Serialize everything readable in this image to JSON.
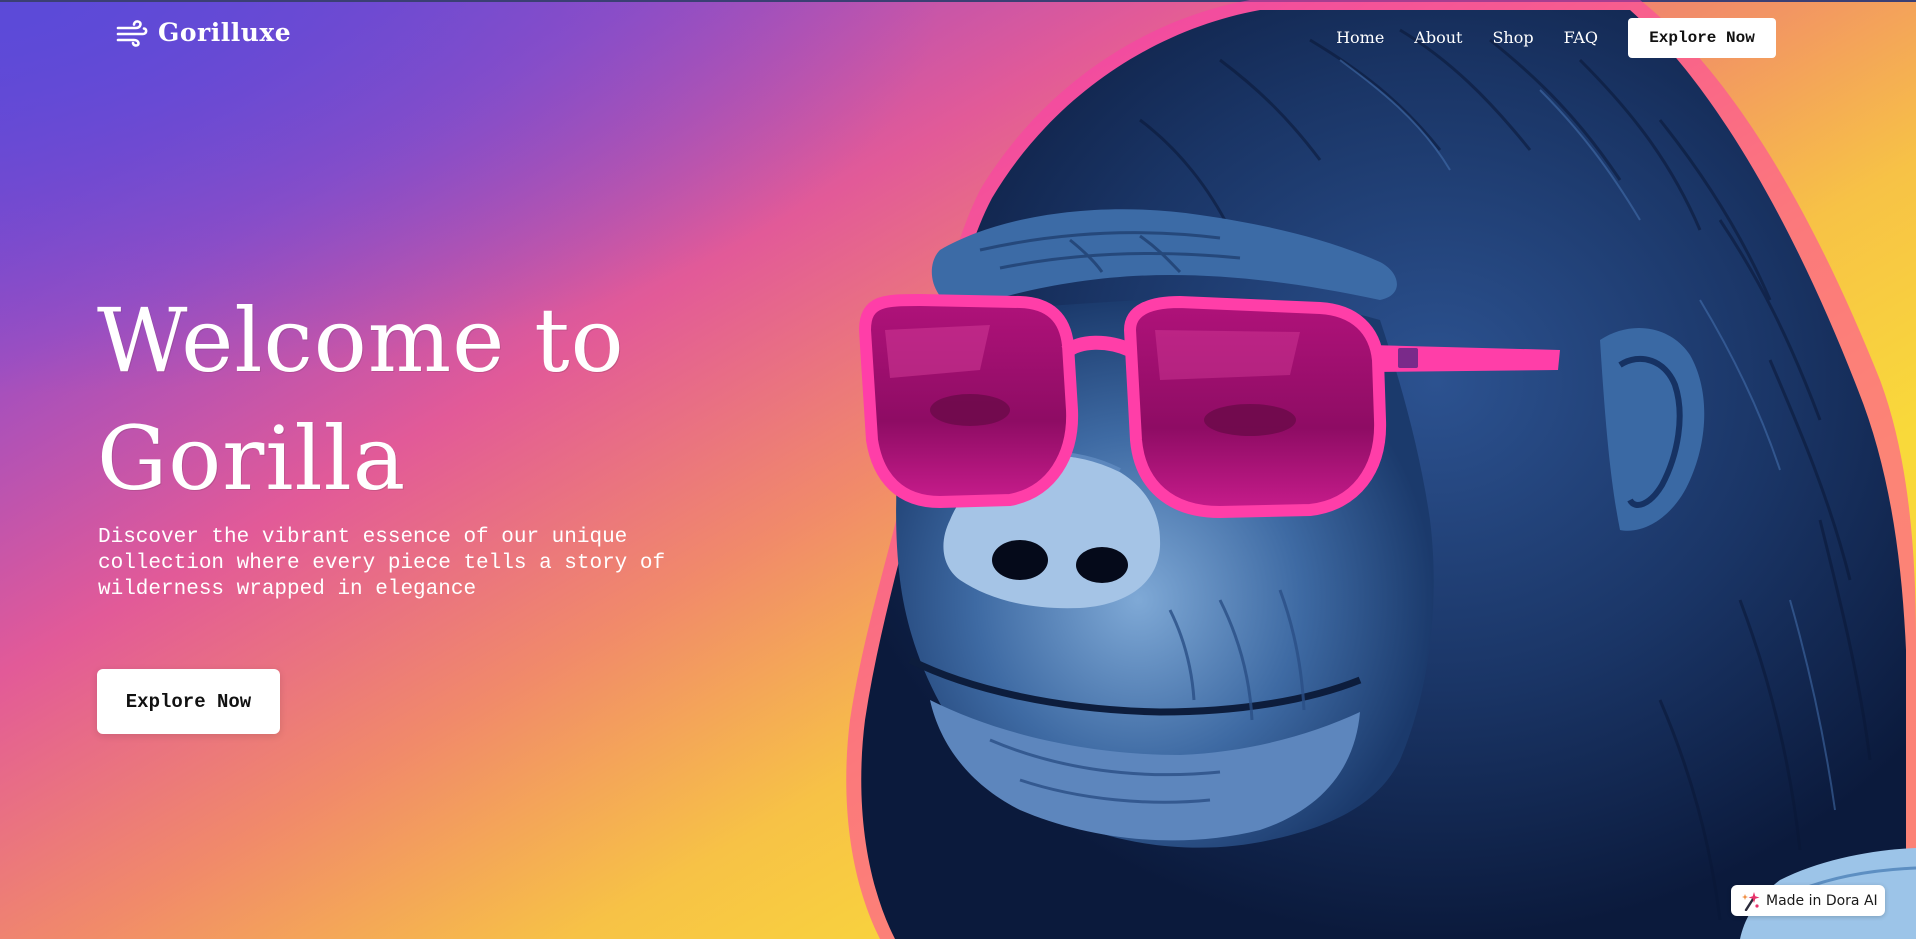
{
  "colors": {
    "accent_pink": "#ff2fa0",
    "gorilla_blue": "#1f3f72",
    "background_purple": "#6a45d6",
    "background_yellow": "#f9d93a",
    "button_bg": "#ffffff"
  },
  "brand": {
    "name": "Gorilluxe",
    "icon": "wind-icon"
  },
  "nav": {
    "items": [
      {
        "label": "Home"
      },
      {
        "label": "About"
      },
      {
        "label": "Shop"
      },
      {
        "label": "FAQ"
      }
    ],
    "cta_label": "Explore Now"
  },
  "hero": {
    "title_line1": "Welcome to",
    "title_line2": "Gorilla",
    "description": "Discover the vibrant essence of our unique collection where every piece tells a story of wilderness wrapped in elegance",
    "cta_label": "Explore Now",
    "image": "gorilla-with-pink-sunglasses-illustration"
  },
  "badge": {
    "label": "Made in Dora AI",
    "icon": "sparkle-icon"
  }
}
